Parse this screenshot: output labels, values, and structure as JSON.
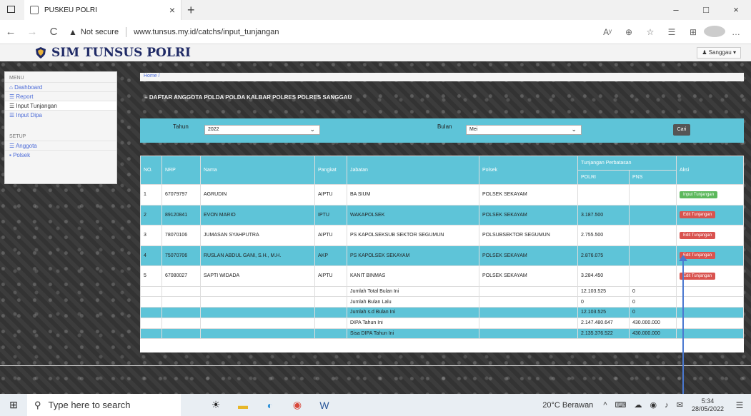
{
  "browser": {
    "tab_title": "PUSKEU POLRI",
    "tab_close": "×",
    "new_tab": "+",
    "back": "←",
    "forward": "→",
    "reload": "C",
    "warn_icon": "▲",
    "not_secure": "Not secure",
    "url": "www.tunsus.my.id/catchs/input_tunjangan",
    "win_min": "–",
    "win_max": "□",
    "win_close": "×",
    "toolbar_icons": [
      "Aʸ",
      "⊕",
      "☆",
      "☰",
      "⊞",
      "…"
    ]
  },
  "app": {
    "brand": "SIM TUNSUS POLRI",
    "user_label": "Sanggau",
    "sidebar": {
      "menu_head": "MENU",
      "items": [
        "Dashboard",
        "Report",
        "Input Tunjangan",
        "Input Dipa"
      ],
      "setup_head": "SETUP",
      "setup_items": [
        "Anggota",
        "Polsek"
      ]
    },
    "breadcrumb": "Home /",
    "page_title": "DAFTAR ANGGOTA POLDA POLDA KALBAR POLRES POLRES SANGGAU",
    "filter": {
      "tahun_label": "Tahun",
      "tahun_value": "2022",
      "bulan_label": "Bulan",
      "bulan_value": "Mei",
      "cari": "Cari"
    },
    "table": {
      "group_header": "Tunjangan Perbatasan",
      "headers": [
        "NO.",
        "NRP",
        "Nama",
        "Pangkat",
        "Jabatan",
        "Polsek",
        "POLRI",
        "PNS",
        "Aksi"
      ],
      "rows": [
        {
          "no": "1",
          "nrp": "67079797",
          "nama": "AGRUDIN",
          "pangkat": "AIPTU",
          "jabatan": "BA SIUM",
          "polsek": "POLSEK SEKAYAM",
          "polri": "",
          "pns": "",
          "aksi": "Input Tunjangan",
          "aksi_type": "green"
        },
        {
          "no": "2",
          "nrp": "89120841",
          "nama": "EVON MARIO",
          "pangkat": "IPTU",
          "jabatan": "WAKAPOLSEK",
          "polsek": "POLSEK SEKAYAM",
          "polri": "3.187.500",
          "pns": "",
          "aksi": "Edit Tunjangan",
          "aksi_type": "red"
        },
        {
          "no": "3",
          "nrp": "78070106",
          "nama": "JUMASAN SYAHPUTRA",
          "pangkat": "AIPTU",
          "jabatan": "PS KAPOLSEKSUB SEKTOR SEGUMUN",
          "polsek": "POLSUBSEKTOR SEGUMUN",
          "polri": "2.755.500",
          "pns": "",
          "aksi": "Edit Tunjangan",
          "aksi_type": "red"
        },
        {
          "no": "4",
          "nrp": "75070706",
          "nama": "RUSLAN ABDUL GANI, S.H., M.H.",
          "pangkat": "AKP",
          "jabatan": "PS KAPOLSEK SEKAYAM",
          "polsek": "POLSEK SEKAYAM",
          "polri": "2.876.075",
          "pns": "",
          "aksi": "Edit Tunjangan",
          "aksi_type": "red"
        },
        {
          "no": "5",
          "nrp": "67080027",
          "nama": "SAPTI WIDADA",
          "pangkat": "AIPTU",
          "jabatan": "KANIT BINMAS",
          "polsek": "POLSEK SEKAYAM",
          "polri": "3.284.450",
          "pns": "",
          "aksi": "Edit Tunjangan",
          "aksi_type": "red"
        }
      ],
      "summary": [
        {
          "label": "Jumlah Total Bulan Ini",
          "polri": "12.103.525",
          "pns": "0"
        },
        {
          "label": "Jumlah Bulan Lalu",
          "polri": "0",
          "pns": "0"
        },
        {
          "label": "Jumlah s.d Bulan Ini",
          "polri": "12.103.525",
          "pns": "0"
        },
        {
          "label": "DIPA Tahun Ini",
          "polri": "2.147.480.647",
          "pns": "430.000.000"
        },
        {
          "label": "Sisa DIPA Tahun Ini",
          "polri": "2.135.376.522",
          "pns": "430.000.000"
        }
      ]
    }
  },
  "taskbar": {
    "start": "⊞",
    "search_icon": "⚲",
    "search_placeholder": "Type here to search",
    "weather": "20°C  Berawan",
    "tray_icons": "^ ⌨ ☁ ◉ ♪ ✉",
    "time": "5:34",
    "date": "28/05/2022",
    "notifications": "☰"
  },
  "colors": {
    "accent": "#5ec4d8",
    "brand": "#1f2a66",
    "danger": "#d9534f",
    "success": "#5cb85c"
  }
}
